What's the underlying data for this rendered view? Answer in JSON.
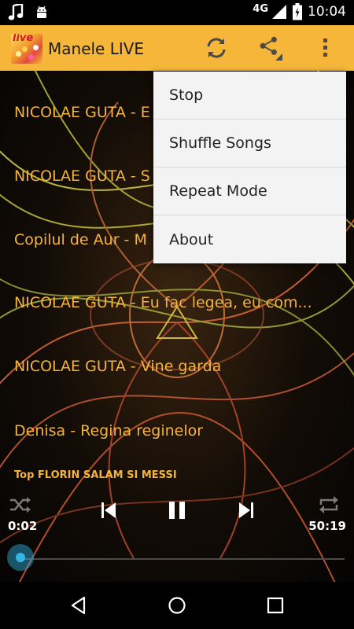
{
  "status_bar": {
    "network": "4G",
    "time": "10:04",
    "left_icons": [
      "music-note-icon",
      "android-icon"
    ],
    "right_icons": [
      "signal-icon",
      "battery-icon"
    ]
  },
  "action_bar": {
    "title": "Manele LIVE",
    "logo_text": "live",
    "accent_color": "#f6b63a",
    "icons": [
      "refresh-icon",
      "share-icon",
      "overflow-menu-icon"
    ]
  },
  "songs": [
    {
      "title": "NICOLAE GUTA - E"
    },
    {
      "title": "NICOLAE GUTA - S"
    },
    {
      "title": "Copilul de Aur - M"
    },
    {
      "title": "NICOLAE GUTA - Eu fac legea, eu com..."
    },
    {
      "title": "NICOLAE GUTA - Vine garda"
    },
    {
      "title": "Denisa - Regina reginelor"
    }
  ],
  "player": {
    "now_playing": "Top FLORIN SALAM SI MESSI",
    "elapsed": "0:02",
    "duration": "50:19",
    "progress": 0.0007,
    "icons": [
      "shuffle-icon",
      "previous-icon",
      "pause-icon",
      "next-icon",
      "repeat-icon"
    ],
    "seek_color": "#33b5e5"
  },
  "menu": {
    "items": [
      {
        "label": "Stop"
      },
      {
        "label": "Shuffle Songs"
      },
      {
        "label": "Repeat Mode"
      },
      {
        "label": "About"
      }
    ]
  },
  "nav_bar": {
    "icons": [
      "back-icon",
      "home-icon",
      "recents-icon"
    ]
  }
}
